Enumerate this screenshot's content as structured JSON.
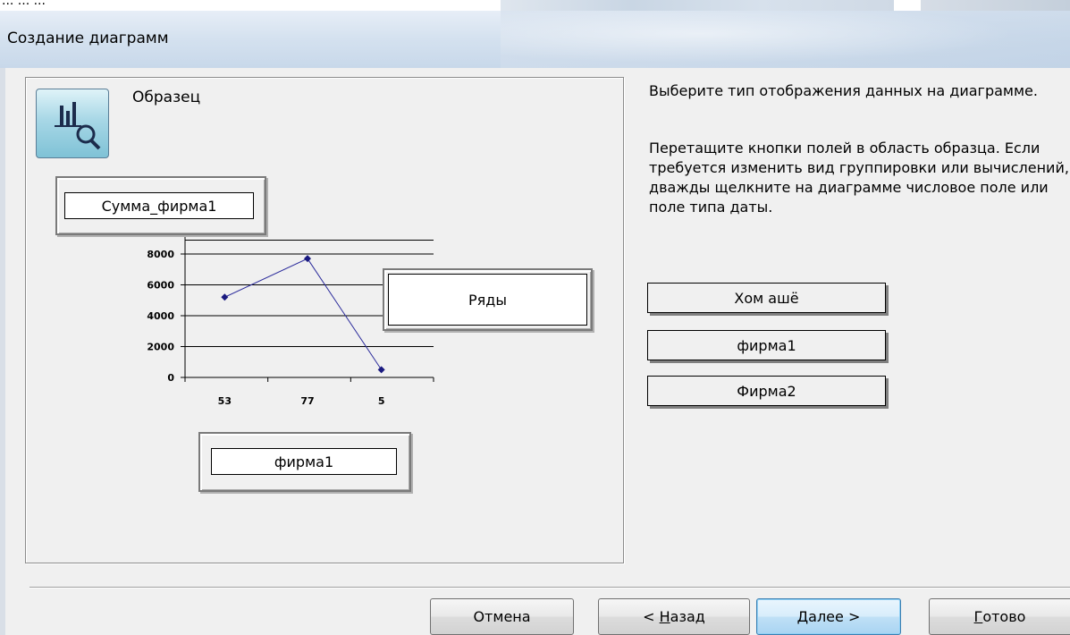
{
  "window": {
    "title": "Создание диаграмм"
  },
  "background_fragment": "... ... ... ",
  "sample": {
    "label": "Образец",
    "icon": "chart-magnifier-icon",
    "value_field": "Сумма_фирма1",
    "series_field": "Ряды",
    "category_field": "фирма1"
  },
  "instructions": {
    "line1": "Выберите тип отображения данных на диаграмме.",
    "line2": "Перетащите кнопки полей в область образца. Если требуется изменить вид группировки или вычислений, дважды щелкните на диаграмме числовое поле или поле типа даты."
  },
  "available_fields": [
    "Хом ашё",
    "фирма1",
    "Фирма2"
  ],
  "buttons": {
    "cancel": "Отмена",
    "back_prefix": "< ",
    "back_mnemonic": "Н",
    "back_rest": "азад",
    "next_mnemonic": "Д",
    "next_rest": "алее >",
    "finish_mnemonic": "Г",
    "finish_rest": "отово"
  },
  "colors": {
    "series_line": "#2b2b9b",
    "series_marker": "#1a1a80",
    "icon_fill": "#a7d7e6"
  },
  "chart_data": {
    "type": "line",
    "categories": [
      "53",
      "77",
      "5"
    ],
    "series": [
      {
        "values": [
          5200,
          7700,
          500
        ]
      }
    ],
    "yticks": [
      "0",
      "2000",
      "4000",
      "6000",
      "8000"
    ],
    "ylim": [
      0,
      8000
    ],
    "grid": true
  }
}
